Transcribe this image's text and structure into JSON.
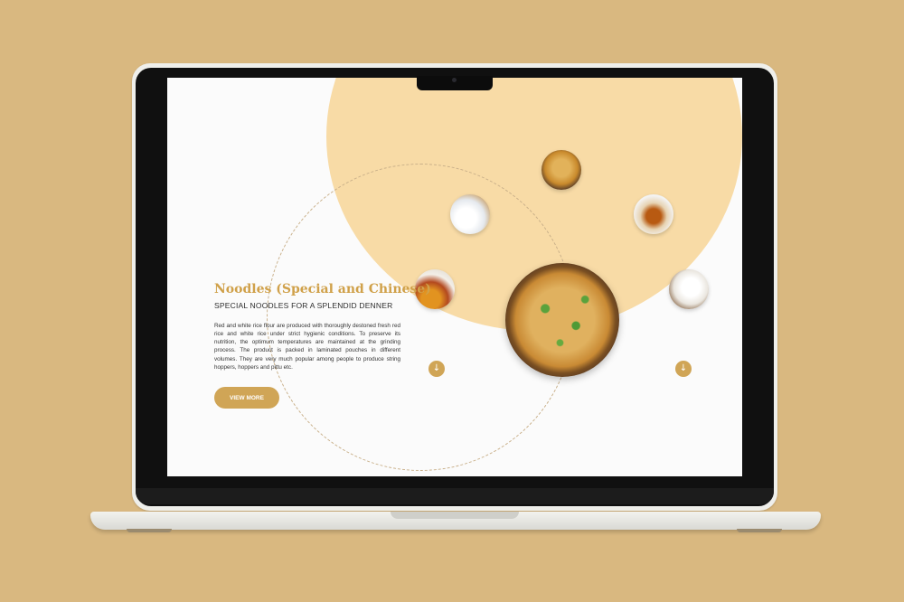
{
  "hero": {
    "title": "Noodles (Special and Chinese)",
    "subtitle": "SPECIAL NOODLES FOR A SPLENDID DENNER",
    "description": "Red and white rice flour are produced with thoroughly destoned fresh red rice and white rice under strict hygienic conditions. To preserve its nutrition, the optimum temperatures are maintained at the grinding process. The product is packed in laminated pouches in different volumes. They are very much popular among people to produce string hoppers, hoppers and pittu etc.",
    "cta_label": "VIEW MORE"
  },
  "carousel": {
    "prev_icon": "↓",
    "next_icon": "↓"
  },
  "colors": {
    "accent": "#d0a556",
    "title": "#d0a14a",
    "circle": "#f8dba6",
    "background": "#d9b880"
  }
}
